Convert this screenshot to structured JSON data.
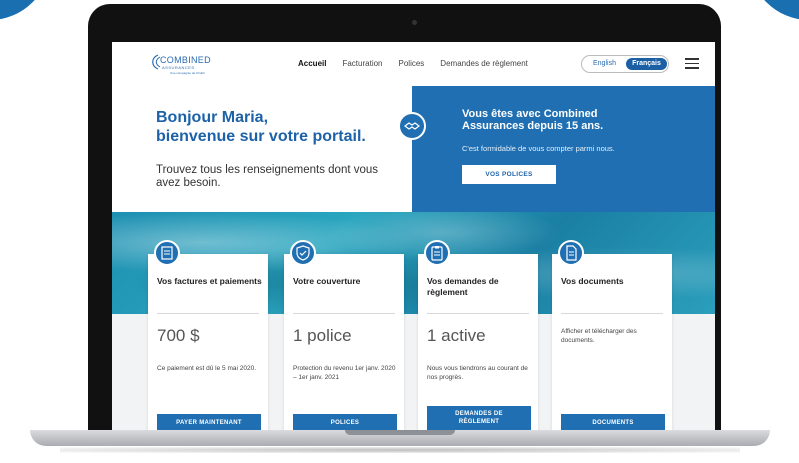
{
  "brand": {
    "name": "COMBINED",
    "sub": "ASSURANCES",
    "tagline": "Une compagnie de Chubb",
    "accent": "#1f6fb2"
  },
  "nav": {
    "links": [
      {
        "label": "Accueil",
        "active": true
      },
      {
        "label": "Facturation",
        "active": false
      },
      {
        "label": "Polices",
        "active": false
      },
      {
        "label": "Demandes de règlement",
        "active": false
      }
    ],
    "lang_en": "English",
    "lang_fr": "Français"
  },
  "hero": {
    "greeting_line1": "Bonjour Maria,",
    "greeting_line2": "bienvenue sur votre portail.",
    "subtitle": "Trouvez tous les renseignements dont vous avez besoin.",
    "right_title_line1": "Vous êtes avec Combined",
    "right_title_line2": "Assurances depuis 15 ans.",
    "right_sub": "C'est formidable de vous compter parmi nous.",
    "right_button": "VOS POLICES"
  },
  "cards": [
    {
      "icon": "invoice-icon",
      "title": "Vos factures et paiements",
      "value": "700 $",
      "desc": "Ce paiement est dû le 5 mai 2020.",
      "button": "PAYER MAINTENANT"
    },
    {
      "icon": "shield-icon",
      "title": "Votre couverture",
      "value": "1 police",
      "desc": "Protection du revenu 1er janv. 2020 – 1er janv. 2021",
      "button": "POLICES"
    },
    {
      "icon": "clipboard-icon",
      "title": "Vos demandes de règlement",
      "value": "1 active",
      "desc": "Nous vous tiendrons au courant de nos progrès.",
      "button_line1": "DEMANDES DE",
      "button_line2": "RÈGLEMENT"
    },
    {
      "icon": "document-icon",
      "title": "Vos documents",
      "desc": "Afficher et télécharger des documents.",
      "button": "DOCUMENTS"
    }
  ]
}
